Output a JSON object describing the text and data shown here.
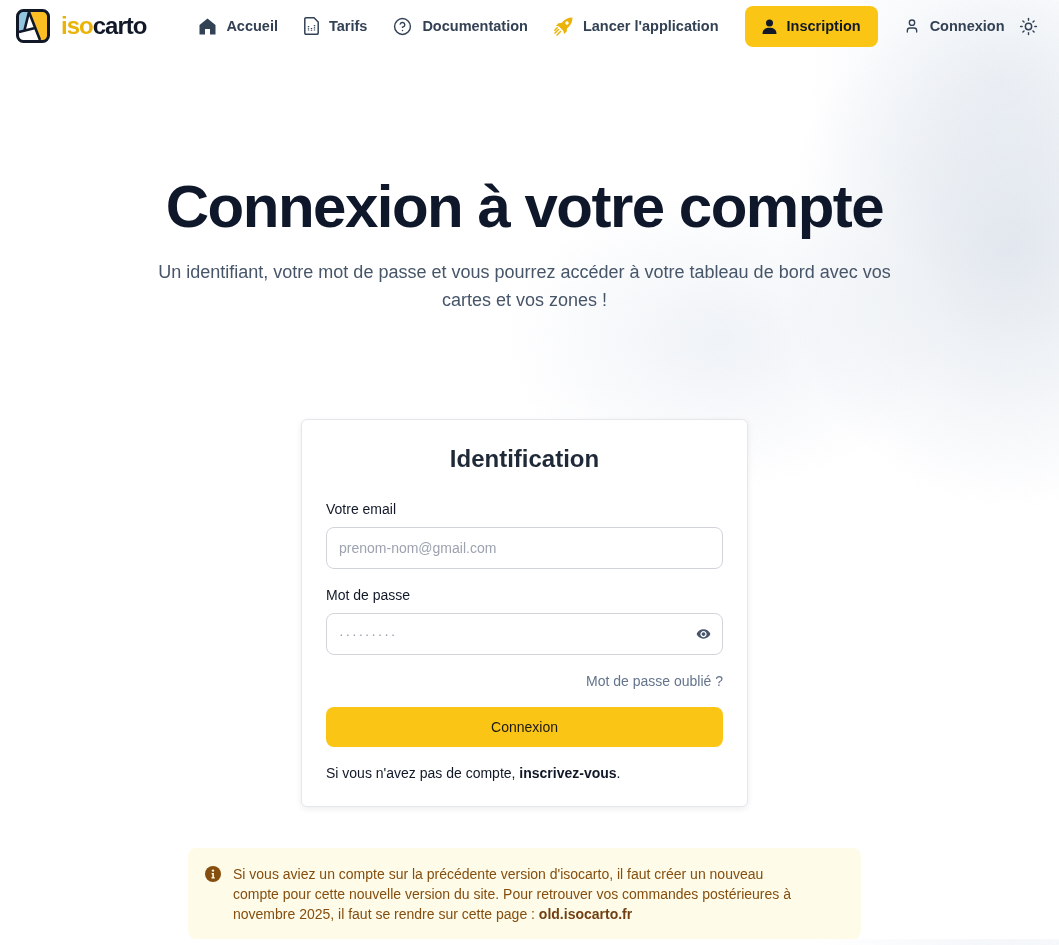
{
  "header": {
    "logo": {
      "prefix": "iso",
      "suffix": "carto"
    },
    "nav": [
      {
        "kind": "link",
        "label": "Accueil"
      },
      {
        "kind": "link",
        "label": "Tarifs"
      },
      {
        "kind": "link",
        "label": "Documentation"
      },
      {
        "kind": "link",
        "label": "Lancer l'application"
      },
      {
        "kind": "button",
        "label": "Inscription"
      },
      {
        "kind": "link",
        "label": "Connexion"
      }
    ]
  },
  "hero": {
    "title": "Connexion à votre compte",
    "subtitle": "Un identifiant, votre mot de passe et vous pourrez accéder à votre tableau de bord avec vos cartes et vos zones !"
  },
  "login_card": {
    "title": "Identification",
    "fields": [
      {
        "kind": "email",
        "label": "Votre email",
        "placeholder": "prenom-nom@gmail.com"
      },
      {
        "kind": "password",
        "label": "Mot de passe",
        "placeholder": "·········"
      }
    ],
    "forgot_link": "Mot de passe oublié ?",
    "submit": "Connexion",
    "signup_prompt": {
      "text": "Si vous n'avez pas de compte,",
      "link": "inscrivez-vous",
      "suffix": "."
    }
  },
  "notice": {
    "text": "Si vous aviez un compte sur la précédente version d'isocarto, il faut créer un nouveau compte pour cette nouvelle version du site. Pour retrouver vos commandes postérieures à novembre 2025, il faut se rendre sur cette page :",
    "link": "old.isocarto.fr"
  }
}
